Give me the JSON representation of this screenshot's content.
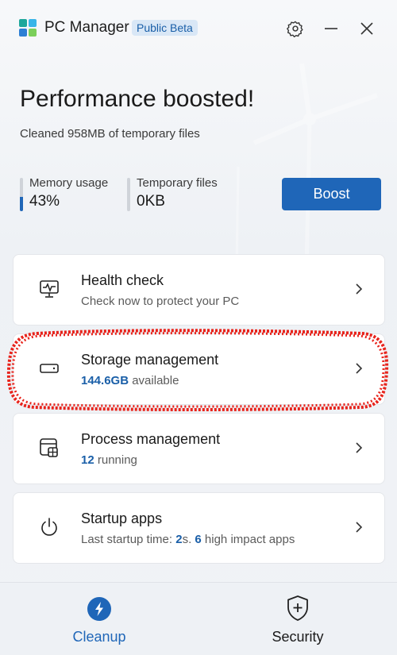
{
  "titlebar": {
    "app_name": "PC Manager",
    "badge": "Public Beta",
    "settings_icon": "gear-icon",
    "minimize_icon": "minimize-icon",
    "close_icon": "close-icon"
  },
  "hero": {
    "title": "Performance boosted!",
    "subtitle": "Cleaned 958MB of temporary files"
  },
  "stats": {
    "memory": {
      "label": "Memory usage",
      "value": "43%",
      "level": 0.43
    },
    "temp": {
      "label": "Temporary files",
      "value": "0KB",
      "level": 0
    }
  },
  "boost_label": "Boost",
  "cards": [
    {
      "title": "Health check",
      "subtitle": "Check now to protect your PC",
      "icon": "monitor-pulse-icon"
    },
    {
      "title": "Storage management",
      "value": "144.6GB",
      "subtitle_suffix": " available",
      "icon": "drive-icon"
    },
    {
      "title": "Process management",
      "value": "12",
      "subtitle_suffix": " running",
      "icon": "process-window-icon"
    },
    {
      "title": "Startup apps",
      "subtitle_prefix": "Last startup time: ",
      "startup_seconds": "2",
      "seconds_unit": "s. ",
      "impact_count": "6",
      "subtitle_suffix": " high impact apps",
      "icon": "power-icon"
    }
  ],
  "tabs": [
    {
      "label": "Cleanup",
      "icon": "lightning-icon",
      "active": true
    },
    {
      "label": "Security",
      "icon": "shield-plus-icon",
      "active": false
    }
  ],
  "colors": {
    "accent": "#1f66b8",
    "highlight": "#e8231b"
  }
}
